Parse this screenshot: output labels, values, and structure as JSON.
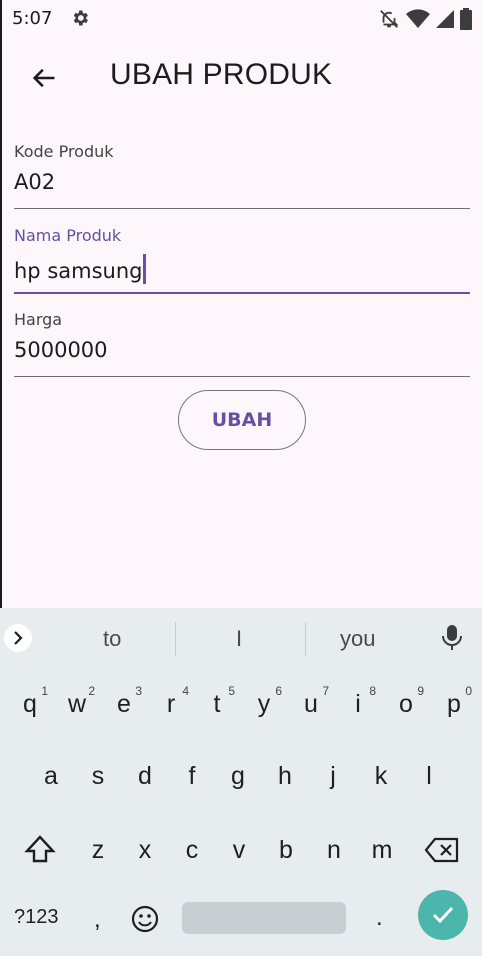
{
  "status_bar": {
    "time": "5:07",
    "icons": [
      "gear-icon",
      "bell-off-icon",
      "wifi-icon",
      "signal-icon",
      "battery-icon"
    ]
  },
  "app_bar": {
    "title": "UBAH PRODUK",
    "back_icon": "arrow-back-icon"
  },
  "form": {
    "kode": {
      "label": "Kode Produk",
      "value": "A02"
    },
    "nama": {
      "label": "Nama Produk",
      "value": "hp samsung"
    },
    "harga": {
      "label": "Harga",
      "value": "5000000"
    },
    "submit_label": "UBAH"
  },
  "keyboard": {
    "suggestions": [
      "to",
      "I",
      "you"
    ],
    "row1": [
      {
        "k": "q",
        "h": "1"
      },
      {
        "k": "w",
        "h": "2"
      },
      {
        "k": "e",
        "h": "3"
      },
      {
        "k": "r",
        "h": "4"
      },
      {
        "k": "t",
        "h": "5"
      },
      {
        "k": "y",
        "h": "6"
      },
      {
        "k": "u",
        "h": "7"
      },
      {
        "k": "i",
        "h": "8"
      },
      {
        "k": "o",
        "h": "9"
      },
      {
        "k": "p",
        "h": "0"
      }
    ],
    "row2": [
      "a",
      "s",
      "d",
      "f",
      "g",
      "h",
      "j",
      "k",
      "l"
    ],
    "row3": [
      "z",
      "x",
      "c",
      "v",
      "b",
      "n",
      "m"
    ],
    "symbols_label": "?123",
    "comma": ",",
    "period": "."
  },
  "colors": {
    "accent": "#6750a4",
    "background": "#fdf7fc",
    "keyboard_bg": "#e7ecef",
    "enter_key": "#4db6ac"
  }
}
